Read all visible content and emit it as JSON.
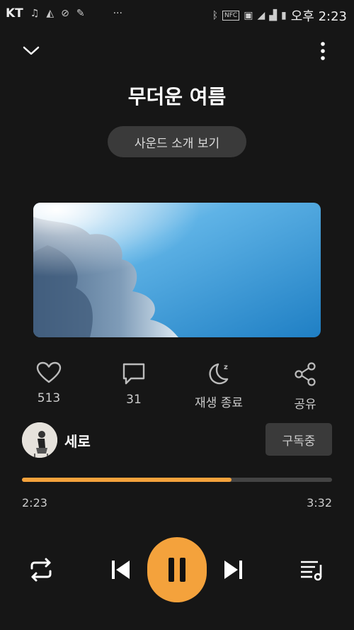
{
  "status_bar": {
    "carrier": "KT",
    "time": "오후 2:23",
    "more": "···",
    "nfc": "NFC"
  },
  "player": {
    "title": "무더운 여름",
    "sound_intro_button": "사운드 소개 보기",
    "likes": "513",
    "comments": "31",
    "sleep_label": "재생 종료",
    "share_label": "공유",
    "artist_name": "세로",
    "subscribe_label": "구독중",
    "elapsed": "2:23",
    "duration": "3:32",
    "progress_fraction": 0.675
  },
  "colors": {
    "accent": "#f4a23c",
    "background": "#161616",
    "button_bg": "#3a3a3a"
  },
  "icons": [
    "chevron-down-icon",
    "more-vert-icon",
    "heart-icon",
    "comment-icon",
    "moon-sleep-icon",
    "share-icon",
    "repeat-icon",
    "previous-icon",
    "pause-icon",
    "next-icon",
    "playlist-icon"
  ]
}
